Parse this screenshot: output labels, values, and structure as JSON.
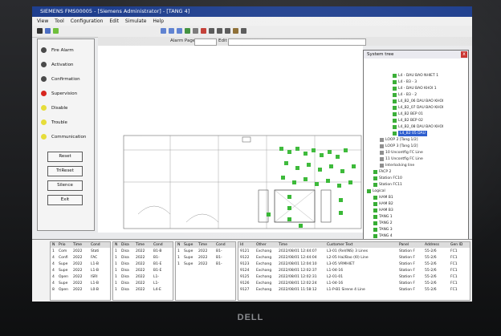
{
  "window": {
    "title": "SIEMENS FMS00005 - [Siemens Administrator] - [TANG 4]"
  },
  "menu": [
    "View",
    "Tool",
    "Configuration",
    "Edit",
    "Simulate",
    "Help"
  ],
  "toolbar2": {
    "page_label": "Alarm Page",
    "edit_label": "Edit"
  },
  "status_panel": [
    {
      "label": "Fire Alarm",
      "color": "#4a4a4a"
    },
    {
      "label": "Activation",
      "color": "#4a4a4a"
    },
    {
      "label": "Confirmation",
      "color": "#4a4a4a"
    },
    {
      "label": "Supervision",
      "color": "#d8261f"
    },
    {
      "label": "Disable",
      "color": "#e6dd3a"
    },
    {
      "label": "Trouble",
      "color": "#e6dd3a"
    },
    {
      "label": "Communication",
      "color": "#e6dd3a"
    }
  ],
  "buttons": {
    "reset": "Reset",
    "trireset": "TriReset",
    "silence": "Silence",
    "exit": "Exit"
  },
  "system_tree": {
    "title": "System tree",
    "close": "x",
    "items": [
      "L4 - DAU BAO NHIET 1",
      "L4 - B3 - 3",
      "L4 - DAU BAO KHOI 1",
      "L4 - B3 - 2",
      "L4_B2_06 DAU BAO KHOI",
      "L4_B2_07 DAU BAO KHOI",
      "L4_B2 BEP 01",
      "L4_B2 BEP 02",
      "L4_B2_08 DAU BAO KHOI",
      "L4_B2 05 DAU",
      "LOOP 2 [Tang 1/2]",
      "LOOP 3 [Tang 1/2]",
      "10 Uncontfig FC Line",
      "11 Uncontfig FC Line",
      "Interlocking line",
      "FACP 2",
      "Station FC10",
      "Station FC11",
      "Logical",
      "HAM B1",
      "HAM B2",
      "HAM B3",
      "TANG 1",
      "TANG 2",
      "TANG 3",
      "TANG 4"
    ]
  },
  "event_grids": {
    "grid1": {
      "headers": [
        "N",
        "Prio",
        "Time",
        "Cond"
      ],
      "rows": [
        [
          "1",
          "Com",
          "2022",
          "Stati"
        ],
        [
          "4",
          "Confi",
          "2022",
          "FAC"
        ],
        [
          "4",
          "Supe",
          "2022",
          "L1-B"
        ],
        [
          "4",
          "Supe",
          "2022",
          "L1-B"
        ],
        [
          "4",
          "Open",
          "2022",
          "ISRI"
        ],
        [
          "4",
          "Supe",
          "2022",
          "L1-B"
        ],
        [
          "8",
          "Open",
          "2022",
          "L0-B"
        ]
      ]
    },
    "grid2": {
      "headers": [
        "N",
        "Disa",
        "Time",
        "Cond"
      ],
      "rows": [
        [
          "1",
          "Disa",
          "2022",
          "B1-B"
        ],
        [
          "1",
          "Disa",
          "2022",
          "B1-"
        ],
        [
          "1",
          "Disa",
          "2022",
          "B1-E"
        ],
        [
          "1",
          "Disa",
          "2022",
          "B1-E"
        ],
        [
          "1",
          "Disa",
          "2022",
          "L1-"
        ],
        [
          "1",
          "Disa",
          "2022",
          "L1-"
        ],
        [
          "1",
          "Disa",
          "2022",
          "L4-E"
        ]
      ]
    },
    "grid3": {
      "headers": [
        "N",
        "Supe",
        "Time",
        "Cond"
      ],
      "rows": [
        [
          "1",
          "Supe",
          "2022",
          "B1-"
        ],
        [
          "1",
          "Supe",
          "2022",
          "B1-"
        ],
        [
          "1",
          "Supe",
          "2022",
          "B1-"
        ]
      ]
    },
    "grid4": {
      "headers": [
        "Id",
        "Other",
        "Time",
        "Customer Text",
        "Panel",
        "Address",
        "Gen ID"
      ],
      "rows": [
        [
          "9121",
          "Exchang",
          "2022/08/01 12:44:07",
          "L3-01 (Rel/INS) 3 Lines",
          "Station F",
          "55-2/6",
          "FC1"
        ],
        [
          "9122",
          "Exchang",
          "2022/08/01 12:44:04",
          "L2-05 Hai/Bao (I0) Line",
          "Station F",
          "55-2/6",
          "FC1"
        ],
        [
          "9123",
          "Exchang",
          "2022/08/01 12:04:10",
          "L3-05 VRMHIET",
          "Station F",
          "55-2/6",
          "FC1"
        ],
        [
          "9124",
          "Exchang",
          "2022/08/01 12:02:37",
          "L1-04-16",
          "Station F",
          "55-2/6",
          "FC1"
        ],
        [
          "9125",
          "Exchang",
          "2022/08/01 12:02:31",
          "L2-01-01",
          "Station F",
          "55-2/6",
          "FC1"
        ],
        [
          "9126",
          "Exchang",
          "2022/08/01 12:02:24",
          "L1-04-16",
          "Station F",
          "55-2/6",
          "FC1"
        ],
        [
          "9127",
          "Exchang",
          "2022/08/01 11:58:12",
          "L1-P-B1 Sirene 4 Line",
          "Station F",
          "55-2/6",
          "FC1"
        ]
      ]
    }
  },
  "brand": "DELL"
}
